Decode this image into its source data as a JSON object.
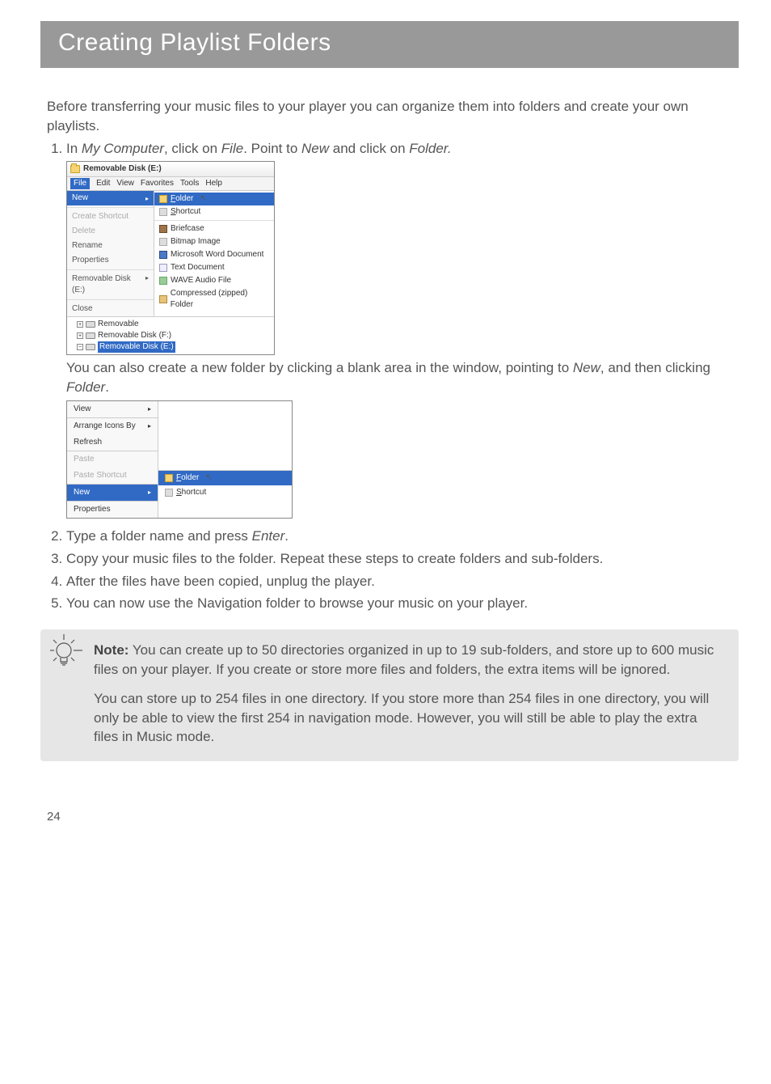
{
  "title": "Creating Playlist Folders",
  "intro": "Before transferring your music files to your player you can organize them into folders and create your own playlists.",
  "steps": {
    "s1_pre": "In ",
    "s1_mycomputer": "My Computer",
    "s1_mid1": ", click on ",
    "s1_file": "File",
    "s1_mid2": ". Point to ",
    "s1_new": "New",
    "s1_mid3": " and click on ",
    "s1_folder": "Folder.",
    "s1_sub_a": "You can also create a new folder by clicking a blank area in the window, pointing to ",
    "s1_sub_new": "New",
    "s1_sub_b": ", and then clicking ",
    "s1_sub_folder": "Folder",
    "s1_sub_c": ".",
    "s2_a": "Type a folder name and press ",
    "s2_enter": "Enter",
    "s2_b": ".",
    "s3": "Copy your music files to the folder. Repeat these steps to create folders and sub-folders.",
    "s4": "After the files have been copied, unplug the player.",
    "s5": "You can now use the Navigation folder to browse your music on your player."
  },
  "ss1": {
    "title": "Removable Disk (E:)",
    "menu": {
      "file": "File",
      "edit": "Edit",
      "view": "View",
      "favorites": "Favorites",
      "tools": "Tools",
      "help": "Help"
    },
    "left": {
      "new": "New",
      "create_shortcut": "Create Shortcut",
      "delete": "Delete",
      "rename": "Rename",
      "properties": "Properties",
      "removable_e": "Removable Disk (E:)",
      "close": "Close"
    },
    "right": {
      "folder": "Folder",
      "shortcut": "Shortcut",
      "briefcase": "Briefcase",
      "bitmap": "Bitmap Image",
      "word": "Microsoft Word Document",
      "text": "Text Document",
      "wave": "WAVE Audio File",
      "zip": "Compressed (zipped) Folder"
    },
    "tree": {
      "removable": "Removable",
      "disk_f": "Removable Disk (F:)",
      "disk_e": "Removable Disk (E:)"
    }
  },
  "ss2": {
    "view": "View",
    "arrange": "Arrange Icons By",
    "refresh": "Refresh",
    "paste": "Paste",
    "paste_shortcut": "Paste Shortcut",
    "new": "New",
    "properties": "Properties",
    "folder": "Folder",
    "shortcut": "Shortcut"
  },
  "note": {
    "label": "Note:",
    "p1": " You can create up to 50 directories organized in up to 19 sub-folders, and store up to 600 music files on your player. If you create or store more files and folders, the extra items will be ignored.",
    "p2": "You can store up to 254 files in one directory. If you store more than 254 files in one directory, you will only be able to view the first 254 in navigation mode. However, you will still be able to play the extra files in Music mode."
  },
  "page_number": "24"
}
